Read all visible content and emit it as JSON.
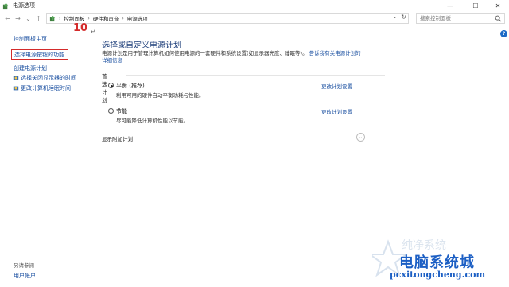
{
  "window": {
    "title": "电源选项",
    "minimize": "—",
    "maximize": "☐",
    "close": "✕"
  },
  "nav": {
    "back": "←",
    "forward": "→",
    "dropdown": "⌄",
    "up": "↑"
  },
  "address": {
    "crumbs": [
      "控制面板",
      "硬件和声音",
      "电源选项"
    ],
    "separator": "›",
    "dropdown": "⌄",
    "refresh": "↻"
  },
  "search": {
    "placeholder": "搜索控制面板"
  },
  "help": "?",
  "sidebar": {
    "home": "控制面板主页",
    "items": [
      {
        "label": "选择电源按钮的功能",
        "highlighted": true
      },
      {
        "label": "创建电源计划"
      },
      {
        "label": "选择关闭显示器的时间",
        "icon": "power-plan-icon"
      },
      {
        "label": "更改计算机睡眠时间",
        "icon": "power-plan-icon"
      }
    ],
    "see_also": "另请参阅",
    "user_accounts": "用户帐户"
  },
  "annotation": {
    "number": "10",
    "mark": "↵",
    "color": "#d42b2b"
  },
  "main": {
    "heading": "选择或自定义电源计划",
    "description": "电源计划是用于管理计算机如何使用电源的一套硬件和系统设置(如显示器亮度、睡眠等)。",
    "description_link": "告诉我有关电源计划的详细信息",
    "preferred_label": "首选计划",
    "plans": [
      {
        "name": "平衡 (推荐)",
        "desc": "利用可用的硬件自动平衡功耗与性能。",
        "selected": true,
        "change": "更改计划设置"
      },
      {
        "name": "节能",
        "desc": "尽可能降低计算机性能以节能。",
        "selected": false,
        "change": "更改计划设置"
      }
    ],
    "more_plans": "显示附加计划",
    "expand": "⌄"
  },
  "watermark": {
    "line1": "电脑系统城",
    "line2": "pcxitongcheng.com",
    "faint": "纯净系统"
  },
  "colors": {
    "link": "#1a4fa0",
    "heading": "#1d3e7a",
    "highlight": "#d42b2b",
    "watermark": "#1c5fc4"
  }
}
